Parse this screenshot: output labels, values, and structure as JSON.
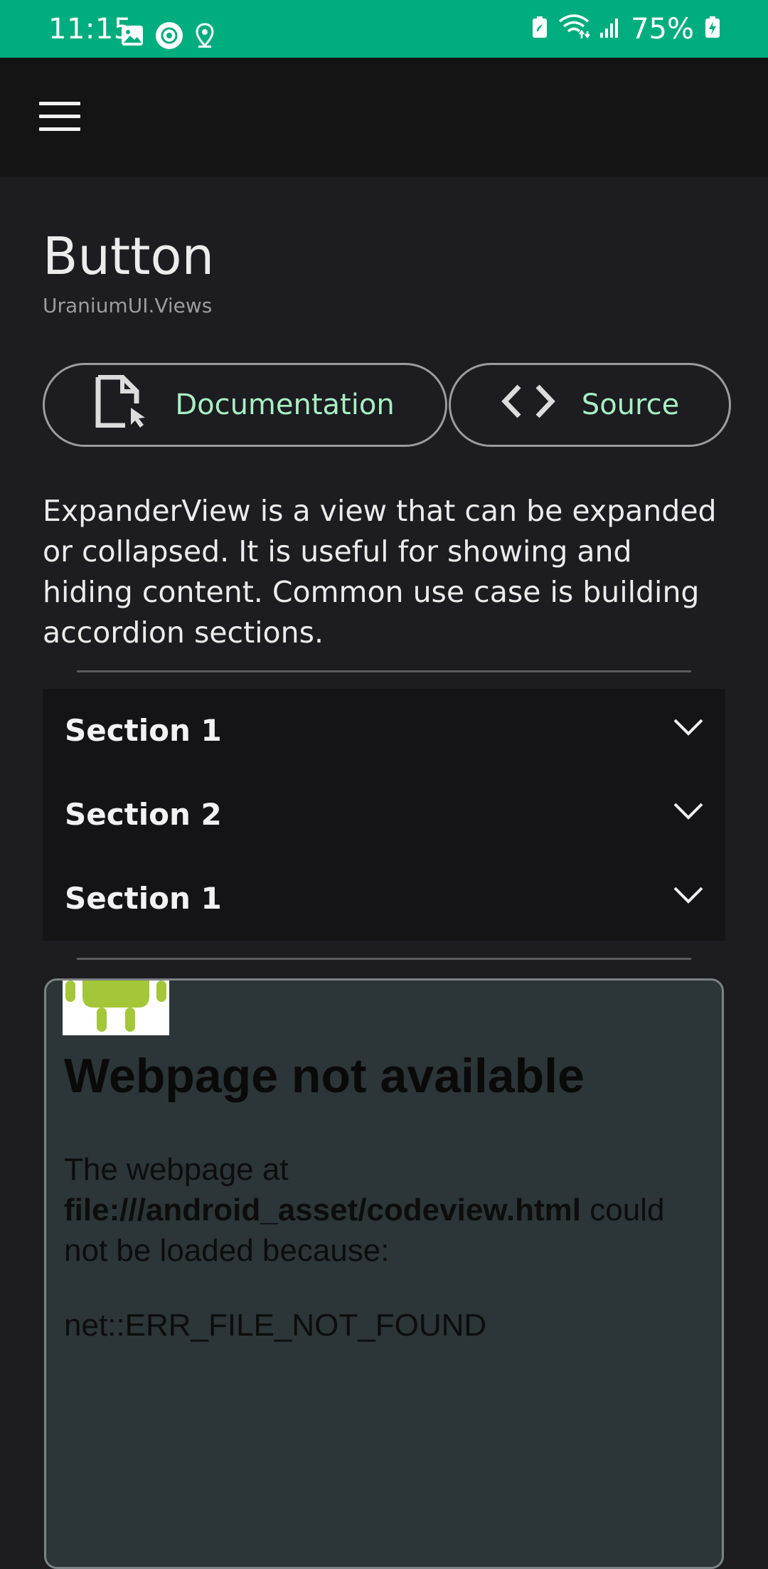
{
  "status_bar": {
    "time": "11:15",
    "battery": "75%",
    "left_icons": [
      "image-icon",
      "recording-icon",
      "location-icon"
    ],
    "right_icons": [
      "battery-saver-icon",
      "wifi-icon",
      "signal-icon",
      "battery-charging-icon"
    ]
  },
  "app_bar": {
    "menu_icon": "hamburger-menu-icon"
  },
  "page": {
    "title": "Button",
    "subtitle": "UraniumUI.Views"
  },
  "buttons": {
    "documentation": {
      "label": "Documentation",
      "icon": "document-cursor-icon"
    },
    "source": {
      "label": "Source",
      "icon": "code-brackets-icon"
    }
  },
  "description": "ExpanderView is a view that can be expanded or collapsed. It is useful for showing and hiding content. Common use case is building accordion sections.",
  "expander": {
    "sections": [
      {
        "label": "Section 1"
      },
      {
        "label": "Section 2"
      },
      {
        "label": "Section 1"
      }
    ]
  },
  "webview": {
    "heading": "Webpage not available",
    "text_before": "The webpage at ",
    "url": "file:///android_asset/codeview.html",
    "text_after": " could not be loaded because:",
    "error": "net::ERR_FILE_NOT_FOUND"
  },
  "colors": {
    "status_bar": "#00ad7e",
    "accent_text": "#a7efc2",
    "background": "#1c1c21"
  }
}
